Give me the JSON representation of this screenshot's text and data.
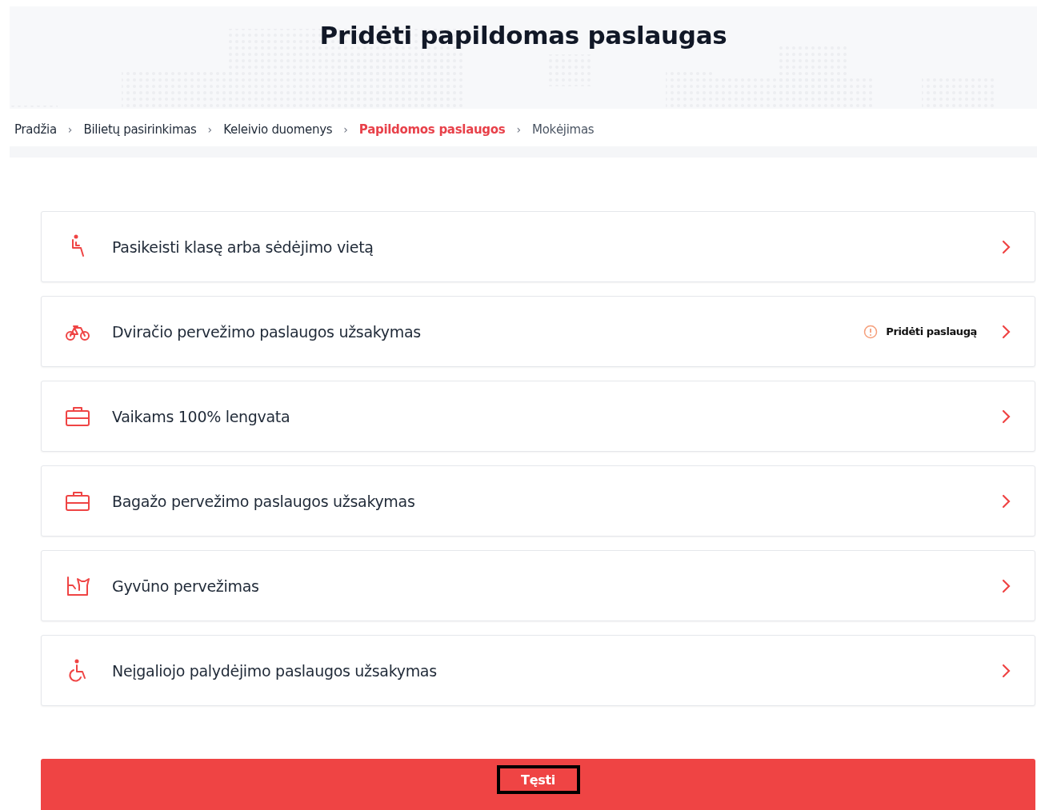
{
  "title": "Pridėti papildomas paslaugas",
  "breadcrumbs": [
    {
      "label": "Pradžia",
      "selected": false,
      "completed": true
    },
    {
      "label": "Bilietų pasirinkimas",
      "selected": false,
      "completed": true,
      "separator": "›"
    },
    {
      "label": "Keleivio duomenys",
      "selected": false,
      "completed": true,
      "separator": "›"
    },
    {
      "label": "Papildomos paslaugos",
      "selected": true,
      "completed": false,
      "separator": "›"
    },
    {
      "label": "Mokėjimas",
      "selected": false,
      "completed": false,
      "separator": "›"
    }
  ],
  "services": [
    {
      "kind": "seat",
      "label": "Pasikeisti klasę arba sėdėjimo vietą"
    },
    {
      "kind": "bicycle",
      "label": "Dviračio pervežimo paslaugos užsakymas",
      "action": "Pridėti paslaugą"
    },
    {
      "kind": "suitcase",
      "label": "Vaikams 100% lengvata"
    },
    {
      "kind": "suitcase",
      "label": "Bagažo pervežimo paslaugos užsakymas"
    },
    {
      "kind": "pet",
      "label": "Gyvūno pervežimas"
    },
    {
      "kind": "wheelchair",
      "label": "Neįgaliojo palydėjimo paslaugos užsakymas"
    }
  ],
  "continue_button": {
    "label": "Tęsti",
    "highlighted": true
  }
}
